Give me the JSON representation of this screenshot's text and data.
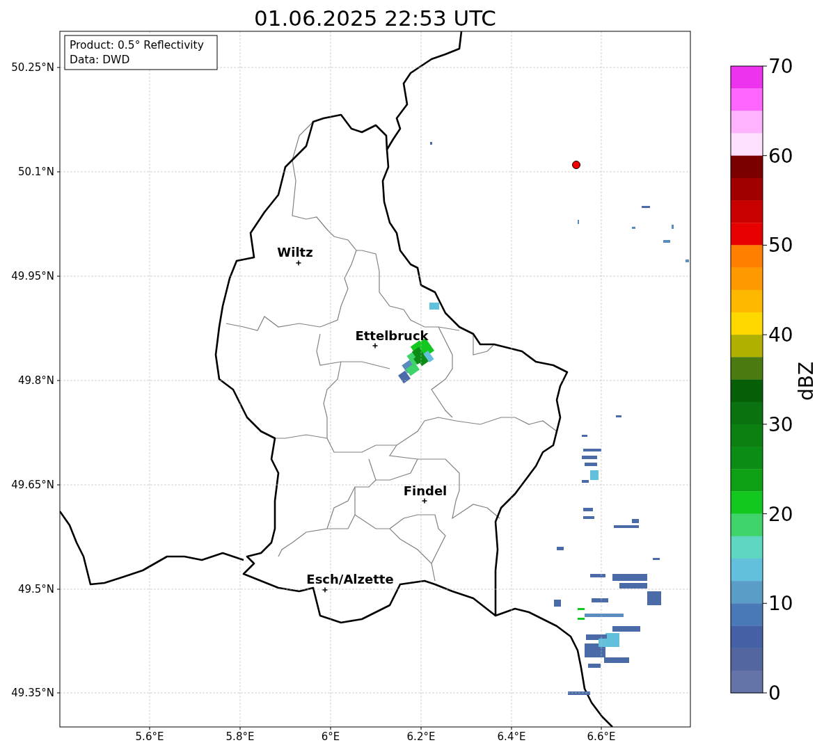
{
  "title": "01.06.2025 22:53 UTC",
  "info_box": [
    "Product: 0.5° Reflectivity",
    "Data: DWD"
  ],
  "x_ticks": [
    "5.6°E",
    "5.8°E",
    "6°E",
    "6.2°E",
    "6.4°E",
    "6.6°E"
  ],
  "y_ticks": [
    "50.25°N",
    "50.1°N",
    "49.95°N",
    "49.8°N",
    "49.65°N",
    "49.5°N",
    "49.35°N"
  ],
  "places": [
    {
      "name": "Wiltz"
    },
    {
      "name": "Ettelbruck"
    },
    {
      "name": "Findel"
    },
    {
      "name": "Esch/Alzette"
    }
  ],
  "colorbar": {
    "label": "dBZ",
    "ticks": [
      "70",
      "60",
      "50",
      "40",
      "30",
      "20",
      "10",
      "0"
    ],
    "segments": [
      {
        "color": "#ee33ee"
      },
      {
        "color": "#ff66ff"
      },
      {
        "color": "#ffb3ff"
      },
      {
        "color": "#ffe0ff"
      },
      {
        "color": "#7a0000"
      },
      {
        "color": "#a00000"
      },
      {
        "color": "#c80000"
      },
      {
        "color": "#e60000"
      },
      {
        "color": "#ff7f00"
      },
      {
        "color": "#ff9900"
      },
      {
        "color": "#ffb800"
      },
      {
        "color": "#ffd800"
      },
      {
        "color": "#b0b000"
      },
      {
        "color": "#4a7a10"
      },
      {
        "color": "#065e06"
      },
      {
        "color": "#0a7210"
      },
      {
        "color": "#0b8010"
      },
      {
        "color": "#0b8c14"
      },
      {
        "color": "#0ea014"
      },
      {
        "color": "#12c81e"
      },
      {
        "color": "#3ed46a"
      },
      {
        "color": "#5fd6c0"
      },
      {
        "color": "#62c0dc"
      },
      {
        "color": "#5a9ec8"
      },
      {
        "color": "#4a7ab5"
      },
      {
        "color": "#4560a4"
      },
      {
        "color": "#5366a0"
      },
      {
        "color": "#6574a8"
      }
    ]
  }
}
